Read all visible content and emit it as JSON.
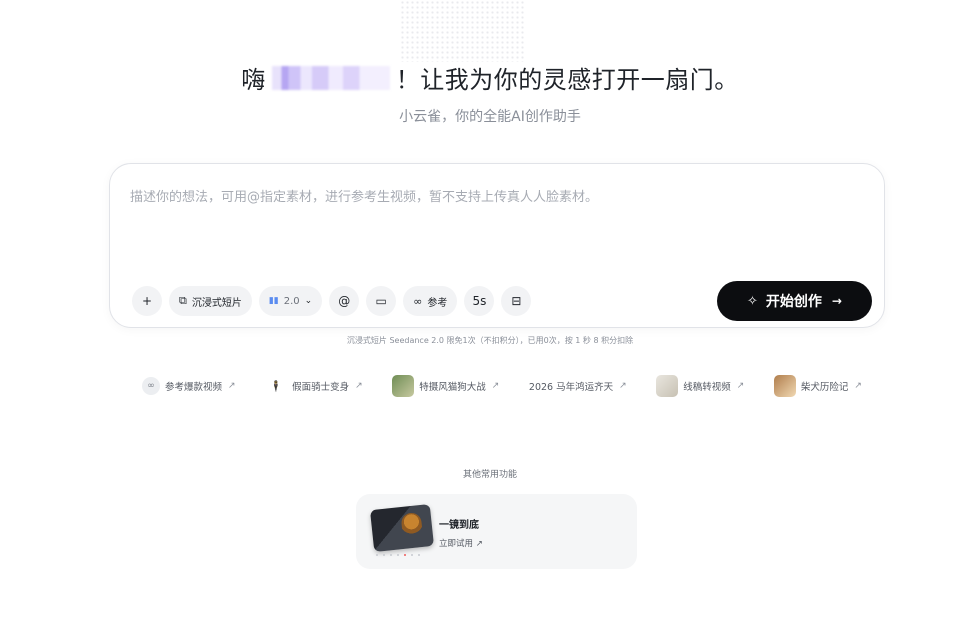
{
  "hero": {
    "greeting_prefix": "嗨",
    "greeting_suffix": "！让我为你的灵感打开一扇门。",
    "subtitle": "小云雀，你的全能AI创作助手"
  },
  "composer": {
    "placeholder": "描述你的想法，可用@指定素材，进行参考生视频，暂不支持上传真人人脸素材。",
    "toolbar": {
      "add": "+",
      "mode_label": "沉浸式短片",
      "model_version": "2.0",
      "mention": "@",
      "reference_label": "参考",
      "duration": "5s"
    },
    "start_label": "开始创作"
  },
  "quota_text": "沉浸式短片 Seedance 2.0 限免1次（不扣积分），已用0次，按 1 秒 8 积分扣除",
  "shortcuts": [
    {
      "label": "参考爆款视频",
      "icon": "link-icon"
    },
    {
      "label": "假面骑士变身",
      "icon": "character-thumbnail"
    },
    {
      "label": "特摄风猫狗大战",
      "icon": "photo-thumbnail"
    },
    {
      "label": "2026 马年鸿运齐天",
      "icon": ""
    },
    {
      "label": "线稿转视频",
      "icon": "sketch-thumbnail"
    },
    {
      "label": "柴犬历险记",
      "icon": "dog-thumbnail"
    }
  ],
  "other_features": {
    "title": "其他常用功能",
    "card": {
      "title": "一镜到底",
      "link": "立即试用"
    }
  },
  "colors": {
    "start_button_bg": "#0c0d10",
    "chip_bg": "#f2f3f5",
    "card_bg": "#f5f6f7",
    "model_accent": "#5a8cf0"
  }
}
